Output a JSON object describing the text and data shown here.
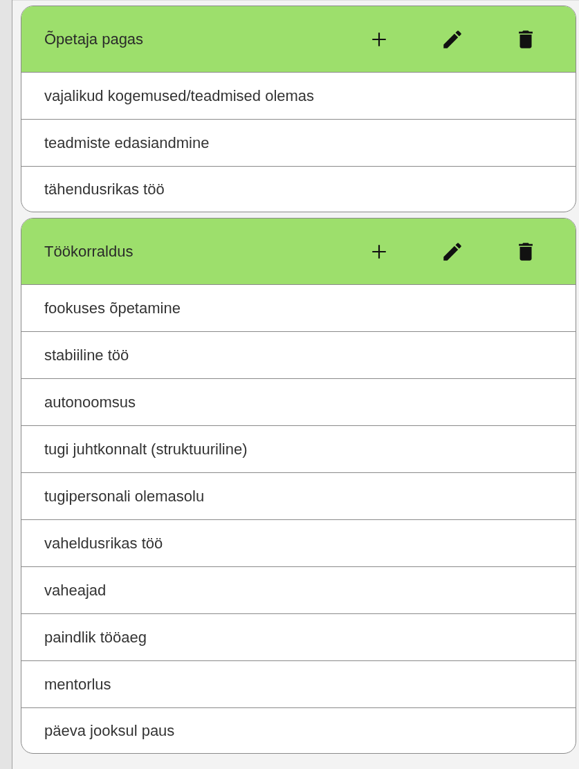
{
  "groups": [
    {
      "title": "Õpetaja pagas",
      "items": [
        "vajalikud kogemused/teadmised olemas",
        "teadmiste edasiandmine",
        "tähendusrikas töö"
      ]
    },
    {
      "title": "Töökorraldus",
      "items": [
        "fookuses õpetamine",
        "stabiiline töö",
        "autonoomsus",
        "tugi juhtkonnalt (struktuuriline)",
        "tugipersonali olemasolu",
        "vaheldusrikas töö",
        "vaheajad",
        "paindlik tööaeg",
        "mentorlus",
        "päeva jooksul paus"
      ]
    }
  ]
}
